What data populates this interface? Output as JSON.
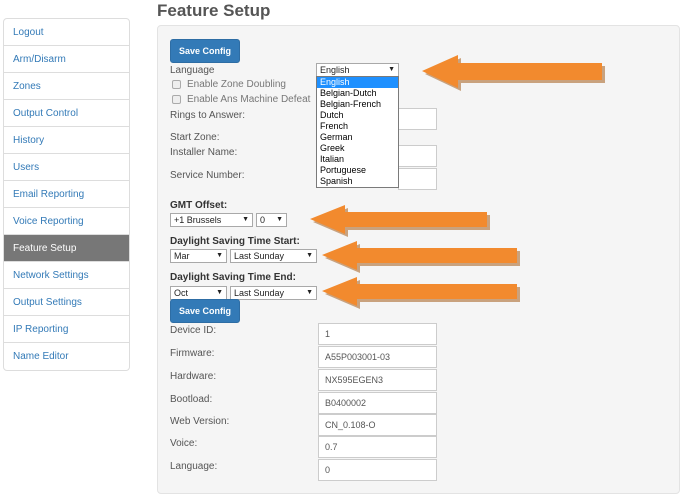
{
  "sidebar": {
    "items": [
      {
        "label": "Logout"
      },
      {
        "label": "Arm/Disarm"
      },
      {
        "label": "Zones"
      },
      {
        "label": "Output Control"
      },
      {
        "label": "History"
      },
      {
        "label": "Users"
      },
      {
        "label": "Email Reporting"
      },
      {
        "label": "Voice Reporting"
      },
      {
        "label": "Feature Setup",
        "active": true
      },
      {
        "label": "Network Settings"
      },
      {
        "label": "Output Settings"
      },
      {
        "label": "IP Reporting"
      },
      {
        "label": "Name Editor"
      }
    ]
  },
  "page": {
    "title": "Feature Setup"
  },
  "form": {
    "save_label": "Save Config",
    "language_label": "Language",
    "language_value": "English",
    "zone_doubling_label": "Enable Zone Doubling",
    "ans_machine_label": "Enable Ans Machine Defeat",
    "rings_label": "Rings to Answer:",
    "start_zone_label": "Start Zone:",
    "installer_label": "Installer Name:",
    "service_label": "Service Number:",
    "gmt_label": "GMT Offset:",
    "gmt_zone_value": "+1 Brussels",
    "gmt_offset_value": "0",
    "dst_start_label": "Daylight Saving Time Start:",
    "dst_start_month": "Mar",
    "dst_start_week": "Last Sunday",
    "dst_end_label": "Daylight Saving Time End:",
    "dst_end_month": "Oct",
    "dst_end_week": "Last Sunday"
  },
  "language_options": [
    "English",
    "Belgian-Dutch",
    "Belgian-French",
    "Dutch",
    "French",
    "German",
    "Greek",
    "Italian",
    "Portuguese",
    "Spanish"
  ],
  "info": {
    "device_id_label": "Device ID:",
    "device_id": "1",
    "firmware_label": "Firmware:",
    "firmware": "A55P003001-03",
    "hardware_label": "Hardware:",
    "hardware": "NX595EGEN3",
    "bootload_label": "Bootload:",
    "bootload": "B0400002",
    "web_version_label": "Web Version:",
    "web_version": "CN_0.108-O",
    "voice_label": "Voice:",
    "voice": "0.7",
    "language_label": "Language:",
    "language": "0"
  },
  "colors": {
    "primary": "#337ab7",
    "active_nav": "#777777",
    "arrow": "#f28a2e",
    "arrow_shadow": "#c9a27e"
  }
}
